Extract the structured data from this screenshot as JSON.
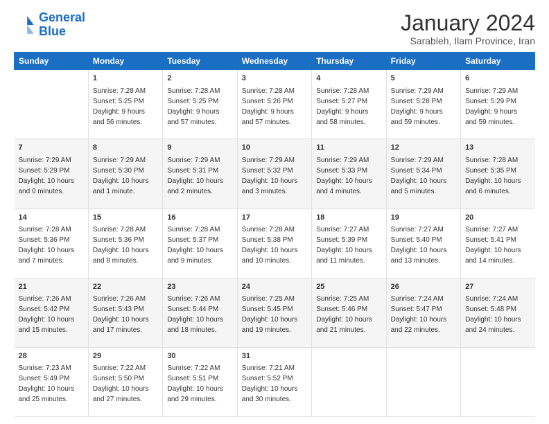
{
  "logo": {
    "line1": "General",
    "line2": "Blue"
  },
  "title": "January 2024",
  "subtitle": "Sarableh, Ilam Province, Iran",
  "columns": [
    "Sunday",
    "Monday",
    "Tuesday",
    "Wednesday",
    "Thursday",
    "Friday",
    "Saturday"
  ],
  "weeks": [
    {
      "cells": [
        {
          "day": null,
          "content": ""
        },
        {
          "day": "1",
          "content": "Sunrise: 7:28 AM\nSunset: 5:25 PM\nDaylight: 9 hours\nand 56 minutes."
        },
        {
          "day": "2",
          "content": "Sunrise: 7:28 AM\nSunset: 5:25 PM\nDaylight: 9 hours\nand 57 minutes."
        },
        {
          "day": "3",
          "content": "Sunrise: 7:28 AM\nSunset: 5:26 PM\nDaylight: 9 hours\nand 57 minutes."
        },
        {
          "day": "4",
          "content": "Sunrise: 7:28 AM\nSunset: 5:27 PM\nDaylight: 9 hours\nand 58 minutes."
        },
        {
          "day": "5",
          "content": "Sunrise: 7:29 AM\nSunset: 5:28 PM\nDaylight: 9 hours\nand 59 minutes."
        },
        {
          "day": "6",
          "content": "Sunrise: 7:29 AM\nSunset: 5:29 PM\nDaylight: 9 hours\nand 59 minutes."
        }
      ]
    },
    {
      "cells": [
        {
          "day": "7",
          "content": "Sunrise: 7:29 AM\nSunset: 5:29 PM\nDaylight: 10 hours\nand 0 minutes."
        },
        {
          "day": "8",
          "content": "Sunrise: 7:29 AM\nSunset: 5:30 PM\nDaylight: 10 hours\nand 1 minute."
        },
        {
          "day": "9",
          "content": "Sunrise: 7:29 AM\nSunset: 5:31 PM\nDaylight: 10 hours\nand 2 minutes."
        },
        {
          "day": "10",
          "content": "Sunrise: 7:29 AM\nSunset: 5:32 PM\nDaylight: 10 hours\nand 3 minutes."
        },
        {
          "day": "11",
          "content": "Sunrise: 7:29 AM\nSunset: 5:33 PM\nDaylight: 10 hours\nand 4 minutes."
        },
        {
          "day": "12",
          "content": "Sunrise: 7:29 AM\nSunset: 5:34 PM\nDaylight: 10 hours\nand 5 minutes."
        },
        {
          "day": "13",
          "content": "Sunrise: 7:28 AM\nSunset: 5:35 PM\nDaylight: 10 hours\nand 6 minutes."
        }
      ]
    },
    {
      "cells": [
        {
          "day": "14",
          "content": "Sunrise: 7:28 AM\nSunset: 5:36 PM\nDaylight: 10 hours\nand 7 minutes."
        },
        {
          "day": "15",
          "content": "Sunrise: 7:28 AM\nSunset: 5:36 PM\nDaylight: 10 hours\nand 8 minutes."
        },
        {
          "day": "16",
          "content": "Sunrise: 7:28 AM\nSunset: 5:37 PM\nDaylight: 10 hours\nand 9 minutes."
        },
        {
          "day": "17",
          "content": "Sunrise: 7:28 AM\nSunset: 5:38 PM\nDaylight: 10 hours\nand 10 minutes."
        },
        {
          "day": "18",
          "content": "Sunrise: 7:27 AM\nSunset: 5:39 PM\nDaylight: 10 hours\nand 11 minutes."
        },
        {
          "day": "19",
          "content": "Sunrise: 7:27 AM\nSunset: 5:40 PM\nDaylight: 10 hours\nand 13 minutes."
        },
        {
          "day": "20",
          "content": "Sunrise: 7:27 AM\nSunset: 5:41 PM\nDaylight: 10 hours\nand 14 minutes."
        }
      ]
    },
    {
      "cells": [
        {
          "day": "21",
          "content": "Sunrise: 7:26 AM\nSunset: 5:42 PM\nDaylight: 10 hours\nand 15 minutes."
        },
        {
          "day": "22",
          "content": "Sunrise: 7:26 AM\nSunset: 5:43 PM\nDaylight: 10 hours\nand 17 minutes."
        },
        {
          "day": "23",
          "content": "Sunrise: 7:26 AM\nSunset: 5:44 PM\nDaylight: 10 hours\nand 18 minutes."
        },
        {
          "day": "24",
          "content": "Sunrise: 7:25 AM\nSunset: 5:45 PM\nDaylight: 10 hours\nand 19 minutes."
        },
        {
          "day": "25",
          "content": "Sunrise: 7:25 AM\nSunset: 5:46 PM\nDaylight: 10 hours\nand 21 minutes."
        },
        {
          "day": "26",
          "content": "Sunrise: 7:24 AM\nSunset: 5:47 PM\nDaylight: 10 hours\nand 22 minutes."
        },
        {
          "day": "27",
          "content": "Sunrise: 7:24 AM\nSunset: 5:48 PM\nDaylight: 10 hours\nand 24 minutes."
        }
      ]
    },
    {
      "cells": [
        {
          "day": "28",
          "content": "Sunrise: 7:23 AM\nSunset: 5:49 PM\nDaylight: 10 hours\nand 25 minutes."
        },
        {
          "day": "29",
          "content": "Sunrise: 7:22 AM\nSunset: 5:50 PM\nDaylight: 10 hours\nand 27 minutes."
        },
        {
          "day": "30",
          "content": "Sunrise: 7:22 AM\nSunset: 5:51 PM\nDaylight: 10 hours\nand 29 minutes."
        },
        {
          "day": "31",
          "content": "Sunrise: 7:21 AM\nSunset: 5:52 PM\nDaylight: 10 hours\nand 30 minutes."
        },
        {
          "day": null,
          "content": ""
        },
        {
          "day": null,
          "content": ""
        },
        {
          "day": null,
          "content": ""
        }
      ]
    }
  ]
}
